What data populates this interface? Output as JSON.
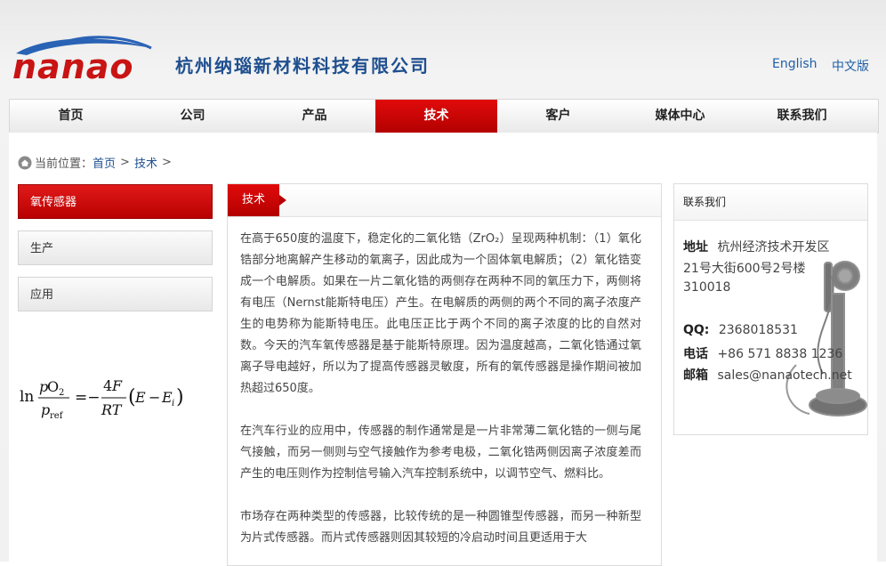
{
  "header": {
    "logo_text": "nanao",
    "company_name": "杭州纳瑙新材料科技有限公司",
    "lang_english": "English",
    "lang_chinese": "中文版"
  },
  "nav": {
    "items": [
      "首页",
      "公司",
      "产品",
      "技术",
      "客户",
      "媒体中心",
      "联系我们"
    ],
    "active": "技术"
  },
  "breadcrumb": {
    "prefix": "当前位置：",
    "home": "首页",
    "current": "技术",
    "separator": ">"
  },
  "sidebar": {
    "items": [
      "氧传感器",
      "生产",
      "应用"
    ],
    "active": "氧传感器"
  },
  "main": {
    "tab_label": "技术",
    "paragraphs": [
      "在高于650度的温度下，稳定化的二氧化锆（ZrO₂）呈现两种机制：（1）氧化锆部分地离解产生移动的氧离子，因此成为一个固体氧电解质；（2）氧化锆变成一个电解质。如果在一片二氧化锆的两侧存在两种不同的氧压力下，两侧将有电压（Nernst能斯特电压）产生。在电解质的两侧的两个不同的离子浓度产生的电势称为能斯特电压。此电压正比于两个不同的离子浓度的比的自然对数。今天的汽车氧传感器是基于能斯特原理。因为温度越高，二氧化锆通过氧离子导电越好，所以为了提高传感器灵敏度，所有的氧传感器是操作期间被加热超过650度。",
      "在汽车行业的应用中，传感器的制作通常是是一片非常薄二氧化锆的一侧与尾气接触，而另一侧则与空气接触作为参考电极，二氧化锆两侧因离子浓度差而产生的电压则作为控制信号输入汽车控制系统中，以调节空气、燃料比。",
      "市场存在两种类型的传感器，比较传统的是一种圆锥型传感器，而另一种新型为片式传感器。而片式传感器则因其较短的冷启动时间且更适用于大"
    ]
  },
  "contact": {
    "title": "联系我们",
    "address_label": "地址",
    "address_line1": "杭州经济技术开发区",
    "address_line2": "21号大街600号2号楼",
    "address_line3": "310018",
    "qq_label": "QQ:",
    "qq_value": "2368018531",
    "phone_label": "电话",
    "phone_value": "+86 571 8838 1236",
    "email_label": "邮箱",
    "email_value": "sales@nanaotech.net"
  },
  "colors": {
    "accent_red": "#c40000",
    "brand_blue": "#1f4f8f",
    "link_blue": "#1f5fa8"
  }
}
